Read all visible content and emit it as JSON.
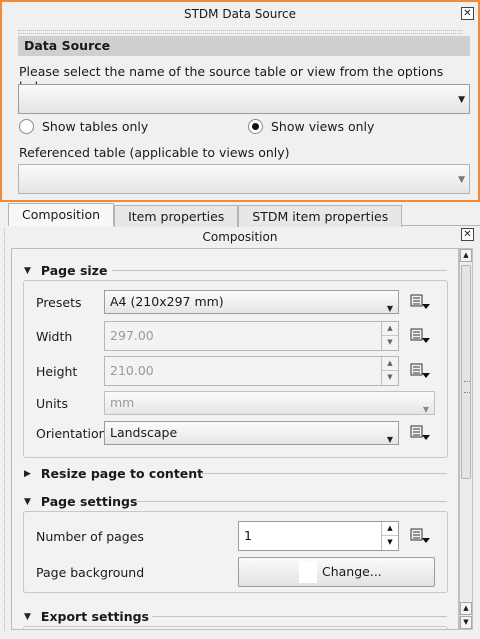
{
  "dock": {
    "title": "STDM Data Source",
    "section_header": "Data Source",
    "prompt": "Please select the name of the source table or view from the options below",
    "source_combo_value": "",
    "radio_tables": "Show tables only",
    "radio_views": "Show views only",
    "selected_radio": "views",
    "referenced_label": "Referenced table (applicable to views only)",
    "referenced_combo_value": ""
  },
  "tabs": [
    {
      "label": "Composition",
      "active": true
    },
    {
      "label": "Item properties",
      "active": false
    },
    {
      "label": "STDM item properties",
      "active": false
    }
  ],
  "composition": {
    "title": "Composition",
    "page_size": {
      "header": "Page size",
      "expanded": true,
      "presets_label": "Presets",
      "presets_value": "A4 (210x297 mm)",
      "width_label": "Width",
      "width_value": "297.00",
      "height_label": "Height",
      "height_value": "210.00",
      "units_label": "Units",
      "units_value": "mm",
      "orientation_label": "Orientation",
      "orientation_value": "Landscape"
    },
    "resize_group": {
      "header": "Resize page to content",
      "expanded": false
    },
    "page_settings": {
      "header": "Page settings",
      "expanded": true,
      "num_pages_label": "Number of pages",
      "num_pages_value": "1",
      "background_label": "Page background",
      "background_button": "Change..."
    },
    "export_group": {
      "header": "Export settings",
      "expanded": true
    }
  },
  "icons": {
    "close": "close-icon",
    "data_defined": "data-defined-override-icon",
    "expand": "triangle-down-icon",
    "collapse": "triangle-right-icon"
  },
  "colors": {
    "dock_highlight": "#f08a3c",
    "section_header_bg": "#cfcfcf"
  }
}
